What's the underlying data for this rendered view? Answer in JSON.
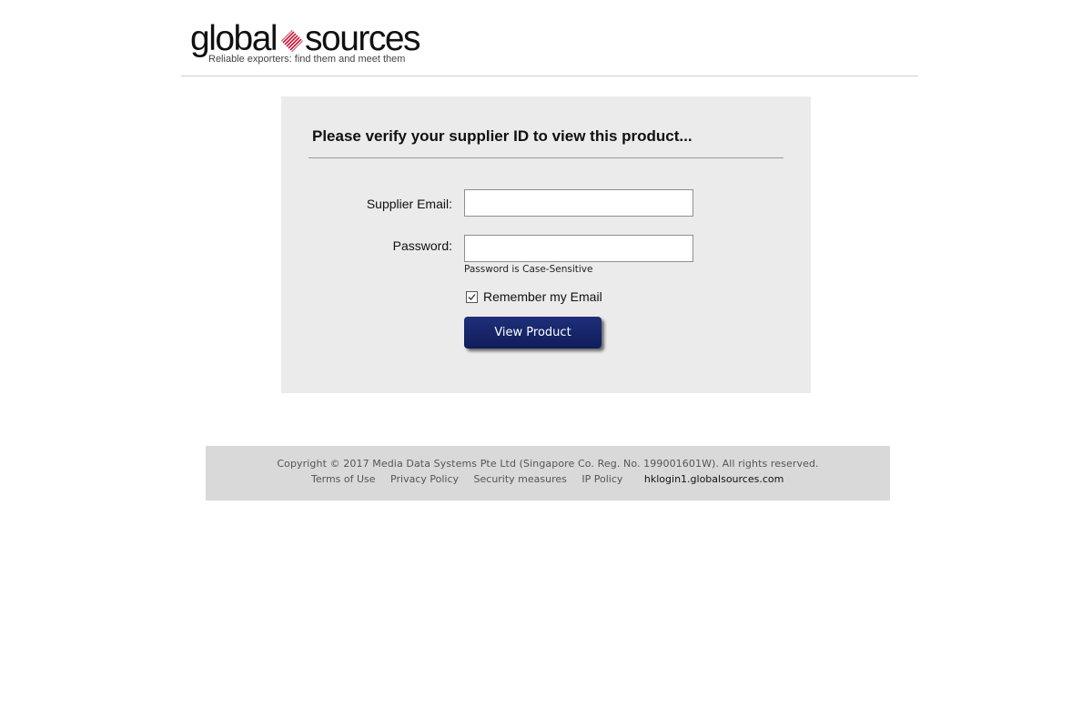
{
  "header": {
    "logo": {
      "word_1": "global",
      "word_2": "sources",
      "tagline": "Reliable exporters: find them and meet them",
      "brand_color": "#c8102e"
    }
  },
  "form": {
    "title": "Please verify your supplier ID to view this product...",
    "email_label": "Supplier Email:",
    "email_value": "",
    "password_label": "Password:",
    "password_value": "",
    "password_hint": "Password is Case-Sensitive",
    "remember_label": "Remember my Email",
    "remember_checked": true,
    "submit_label": "View Product",
    "button_color": "#132266",
    "panel_color": "#ebebeb"
  },
  "footer": {
    "copyright": "Copyright © 2017 Media Data Systems Pte Ltd (Singapore Co. Reg. No. 199001601W). All rights reserved.",
    "links": [
      {
        "label": "Terms of Use"
      },
      {
        "label": "Privacy Policy"
      },
      {
        "label": "Security measures"
      },
      {
        "label": "IP Policy"
      }
    ],
    "server": "hklogin1.globalsources.com",
    "background_color": "#d9d9d9"
  }
}
